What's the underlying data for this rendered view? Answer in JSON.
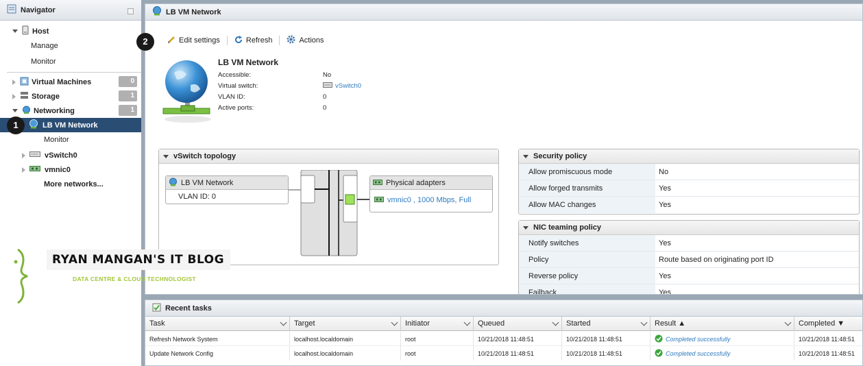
{
  "navigator": {
    "title": "Navigator",
    "host": "Host",
    "manage": "Manage",
    "monitor": "Monitor",
    "virtual_machines": {
      "label": "Virtual Machines",
      "count": "0"
    },
    "storage": {
      "label": "Storage",
      "count": "1"
    },
    "networking": {
      "label": "Networking",
      "count": "1"
    },
    "lb_vm_network": "LB VM Network",
    "network_monitor": "Monitor",
    "vswitch0": "vSwitch0",
    "vmnic0": "vmnic0",
    "more_networks": "More networks..."
  },
  "annotations": {
    "step1": "1",
    "step2": "2"
  },
  "main": {
    "title": "LB VM Network",
    "toolbar": {
      "edit": "Edit settings",
      "refresh": "Refresh",
      "actions": "Actions"
    },
    "info": {
      "name": "LB VM Network",
      "rows": [
        {
          "k": "Accessible:",
          "v": "No"
        },
        {
          "k": "Virtual switch:",
          "v": "vSwitch0"
        },
        {
          "k": "VLAN ID:",
          "v": "0"
        },
        {
          "k": "Active ports:",
          "v": "0"
        }
      ]
    },
    "topology": {
      "title": "vSwitch topology",
      "portgroup_name": "LB VM Network",
      "vlan": "VLAN ID: 0",
      "adapters_title": "Physical adapters",
      "adapter": "vmnic0 , 1000 Mbps, Full"
    },
    "security": {
      "title": "Security policy",
      "rows": [
        {
          "k": "Allow promiscuous mode",
          "v": "No"
        },
        {
          "k": "Allow forged transmits",
          "v": "Yes"
        },
        {
          "k": "Allow MAC changes",
          "v": "Yes"
        }
      ]
    },
    "nic": {
      "title": "NIC teaming policy",
      "rows": [
        {
          "k": "Notify switches",
          "v": "Yes"
        },
        {
          "k": "Policy",
          "v": "Route based on originating port ID"
        },
        {
          "k": "Reverse policy",
          "v": "Yes"
        },
        {
          "k": "Failback",
          "v": "Yes"
        }
      ]
    }
  },
  "tasks": {
    "title": "Recent tasks",
    "columns": [
      "Task",
      "Target",
      "Initiator",
      "Queued",
      "Started",
      "Result ▲",
      "Completed ▼"
    ],
    "rows": [
      [
        "Refresh Network System",
        "localhost.localdomain",
        "root",
        "10/21/2018 11:48:51",
        "10/21/2018 11:48:51",
        "Completed successfully",
        "10/21/2018 11:48:51"
      ],
      [
        "Update Network Config",
        "localhost.localdomain",
        "root",
        "10/21/2018 11:48:51",
        "10/21/2018 11:48:51",
        "Completed successfully",
        "10/21/2018 11:48:51"
      ]
    ]
  },
  "watermark": {
    "title": "RYAN MANGAN'S IT BLOG",
    "subtitle": "DATA CENTRE & CLOUD TECHNOLOGIST"
  },
  "colors": {
    "selected": "#2a4d73",
    "link": "#2f7abf",
    "success": "#3aa53a",
    "brand_green": "#a3c639"
  }
}
